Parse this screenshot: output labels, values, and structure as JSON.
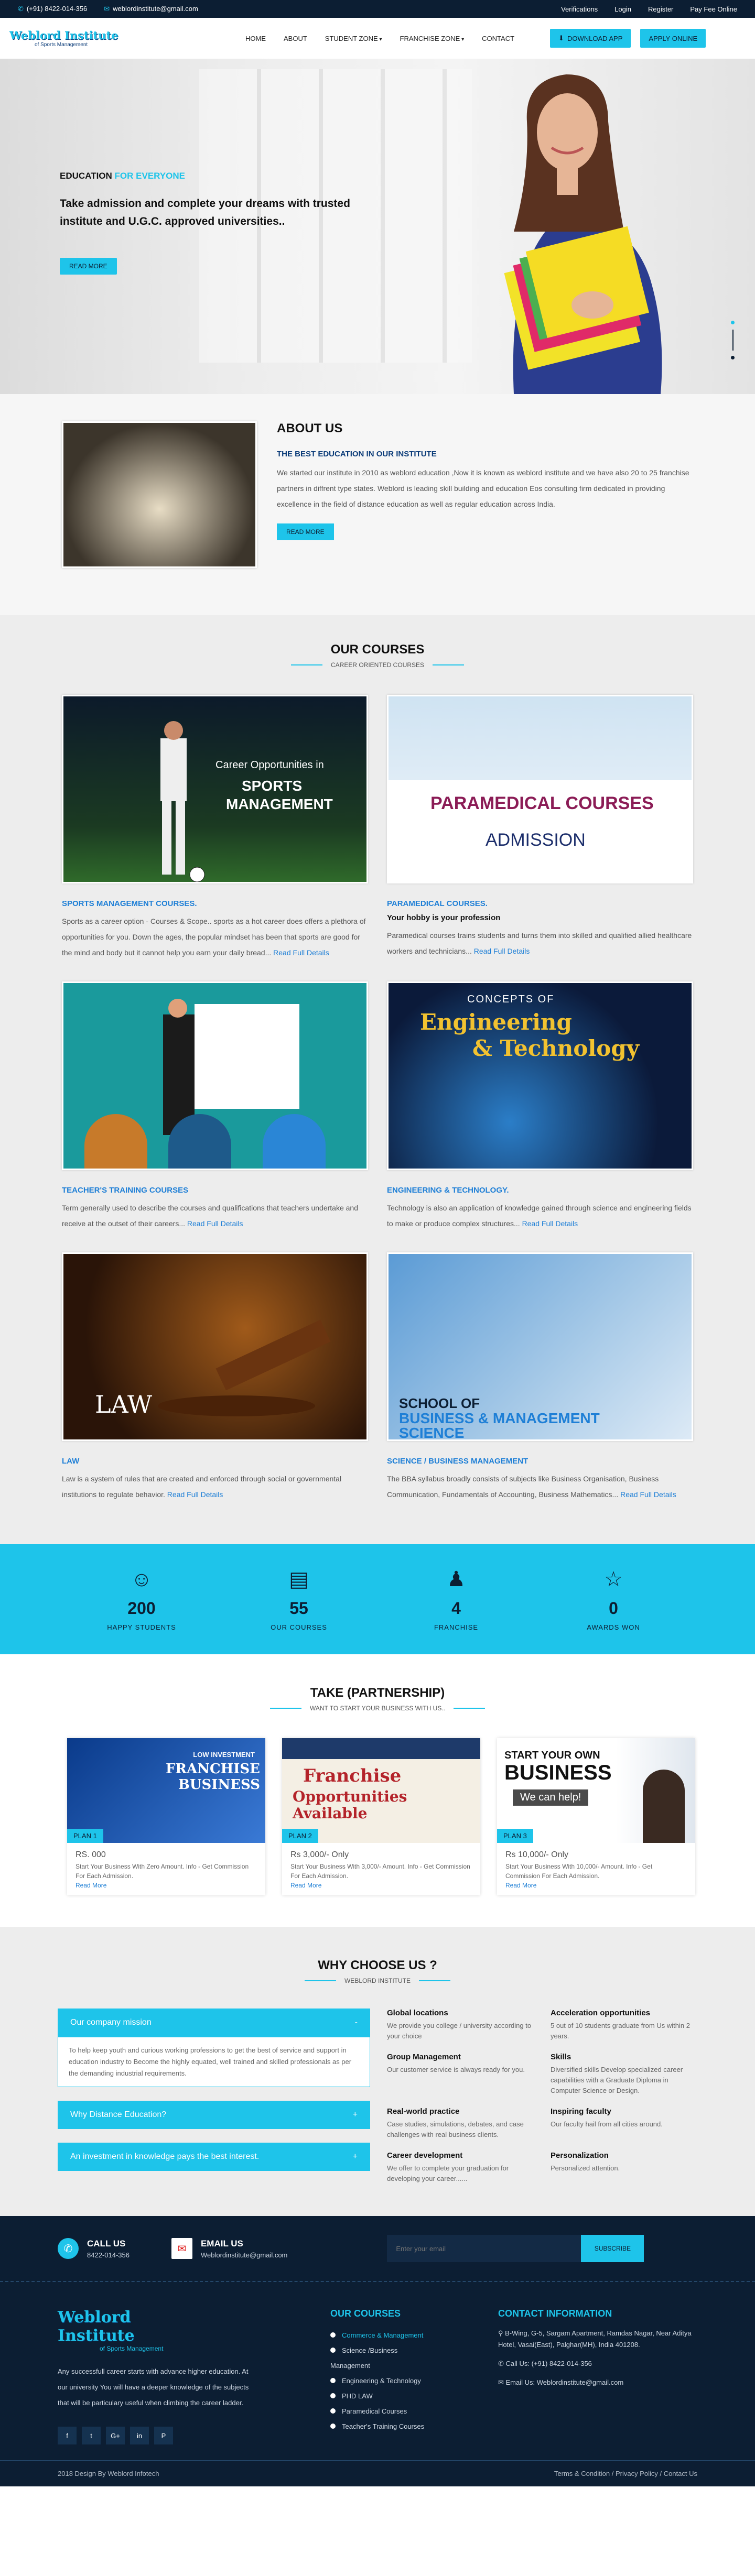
{
  "topbar": {
    "phone": "(+91) 8422-014-356",
    "email": "weblordinstitute@gmail.com",
    "links": [
      "Verifications",
      "Login",
      "Register",
      "Pay Fee Online"
    ]
  },
  "nav": {
    "logo_name": "Weblord Institute",
    "logo_tag": "of Sports Management",
    "items": [
      "HOME",
      "ABOUT",
      "STUDENT ZONE",
      "FRANCHISE ZONE",
      "CONTACT"
    ],
    "download": "DOWNLOAD APP",
    "apply": "APPLY ONLINE"
  },
  "hero": {
    "ed1": "EDUCATION",
    "ed2": "FOR EVERYONE",
    "heading": "Take admission and complete your dreams with trusted institute and U.G.C. approved universities..",
    "btn": "READ MORE"
  },
  "about": {
    "title": "ABOUT US",
    "subtitle": "THE BEST EDUCATION IN OUR INSTITUTE",
    "text": "We started our institute in 2010 as weblord education ,Now it is known as weblord institute and we have also 20 to 25 franchise partners in diffrent type states. Weblord is leading skill building and education Eos consulting firm dedicated in providing excellence in the field of distance education as well as regular education across India.",
    "btn": "READ MORE"
  },
  "courses": {
    "title": "OUR COURSES",
    "subtitle": "CAREER ORIENTED COURSES",
    "read": "Read Full Details",
    "items": [
      {
        "title": "SPORTS MANAGEMENT COURSES.",
        "hobby": "",
        "text": "Sports as a career option - Courses & Scope.. sports as a hot career does offers a plethora of opportunities for you. Down the ages, the popular mindset has been that sports are good for the mind and body but it cannot help you earn your daily bread...",
        "img1": "Career Opportunities in",
        "img2": "SPORTS",
        "img3": "MANAGEMENT"
      },
      {
        "title": "PARAMEDICAL COURSES.",
        "hobby": "Your hobby is your profession",
        "text": "Paramedical courses trains students and turns them into skilled and qualified allied healthcare workers and technicians...",
        "img1": "PARAMEDICAL COURSES",
        "img2": "ADMISSION",
        "img3": ""
      },
      {
        "title": "TEACHER'S TRAINING COURSES",
        "hobby": "",
        "text": "Term generally used to describe the courses and qualifications that teachers undertake and receive at the outset of their careers...",
        "img1": "",
        "img2": "",
        "img3": ""
      },
      {
        "title": "ENGINEERING & TECHNOLOGY.",
        "hobby": "",
        "text": "Technology is also an application of knowledge gained through science and engineering fields to make or produce complex structures...",
        "img1": "CONCEPTS OF",
        "img2": "Engineering",
        "img3": "& Technology"
      },
      {
        "title": "LAW",
        "hobby": "",
        "text": "Law is a system of rules that are created and enforced through social or governmental institutions to regulate behavior.",
        "img1": "LAW",
        "img2": "",
        "img3": ""
      },
      {
        "title": "SCIENCE / BUSINESS MANAGEMENT",
        "hobby": "",
        "text": "The BBA syllabus broadly consists of subjects like Business Organisation, Business Communication, Fundamentals of Accounting, Business Mathematics...",
        "img1": "SCHOOL OF",
        "img2": "BUSINESS & MANAGEMENT",
        "img3": "SCIENCE"
      }
    ]
  },
  "stats": [
    {
      "num": "200",
      "label": "HAPPY STUDENTS",
      "icon": "smile-icon"
    },
    {
      "num": "55",
      "label": "OUR COURSES",
      "icon": "board-icon"
    },
    {
      "num": "4",
      "label": "FRANCHISE",
      "icon": "people-icon"
    },
    {
      "num": "0",
      "label": "AWARDS WON",
      "icon": "trophy-icon"
    }
  ],
  "partner": {
    "title": "TAKE (PARTNERSHIP)",
    "subtitle": "WANT TO START YOUR BUSINESS WITH US..",
    "plans": [
      {
        "plan": "PLAN 1",
        "price": "RS. 000",
        "desc": "Start Your Business With Zero Amount. Info - Get Commission For Each Admission.",
        "rm": "Read More",
        "img1": "LOW INVESTMENT",
        "img2": "FRANCHISE BUSINESS"
      },
      {
        "plan": "PLAN 2",
        "price": "Rs 3,000/- Only",
        "desc": "Start Your Business With 3,000/- Amount. Info - Get Commission For Each Admission.",
        "rm": "Read More",
        "img1": "Franchise",
        "img2": "Opportunities Available"
      },
      {
        "plan": "PLAN 3",
        "price": "Rs 10,000/- Only",
        "desc": "Start Your Business With 10,000/- Amount. Info - Get Commission For Each Admission.",
        "rm": "Read More",
        "img1": "START YOUR OWN",
        "img2": "BUSINESS",
        "img3": "We can help!"
      }
    ]
  },
  "why": {
    "title": "WHY CHOOSE US ?",
    "subtitle": "WEBLORD INSTITUTE",
    "acc": [
      {
        "label": "Our company mission",
        "sign": "-",
        "body": "To help keep youth and curious working professions to get the best of service and support in education industry to Become the highly equated, well trained and skilled professionals as per the demanding industrial requirements."
      },
      {
        "label": "Why Distance Education?",
        "sign": "+"
      },
      {
        "label": "An investment in knowledge pays the best interest.",
        "sign": "+"
      }
    ],
    "features": [
      {
        "t": "Global locations",
        "d": "We provide you college / university according to your choice"
      },
      {
        "t": "Acceleration opportunities",
        "d": "5 out of 10 students graduate from Us within 2 years."
      },
      {
        "t": "Group Management",
        "d": "Our customer service is always ready for you."
      },
      {
        "t": "Skills",
        "d": "Diversified skills Develop specialized career capabilities with a Graduate Diploma in Computer Science or Design."
      },
      {
        "t": "Real-world practice",
        "d": "Case studies, simulations, debates, and case challenges with real business clients."
      },
      {
        "t": "Inspiring faculty",
        "d": "Our faculty hail from all cities around."
      },
      {
        "t": "Career development",
        "d": "We offer to complete your graduation for developing your career......"
      },
      {
        "t": "Personalization",
        "d": "Personalized attention."
      }
    ]
  },
  "contact": {
    "call_t": "CALL US",
    "call_v": "8422-014-356",
    "mail_t": "EMAIL US",
    "mail_v": "Weblordinstitute@gmail.com",
    "placeholder": "Enter your email",
    "subscribe": "SUBSCRIBE"
  },
  "footer": {
    "logo_name": "Weblord Institute",
    "logo_tag": "of Sports Management",
    "about": "Any successfull career starts with advance higher education. At our university You will have a deeper knowledge of the subjects that will be particulary useful when climbing the career ladder.",
    "courses_t": "OUR COURSES",
    "courses": [
      "Commerce & Management",
      "Science /Business Management",
      "Engineering & Technology",
      "PHD LAW",
      "Paramedical Courses",
      "Teacher's Training Courses"
    ],
    "contact_t": "CONTACT INFORMATION",
    "address": "B-Wing, G-5, Sargam Apartment, Ramdas Nagar, Near Aditya Hotel, Vasai(East), Palghar(MH), India 401208.",
    "call": "Call Us: (+91) 8422-014-356",
    "mail": "Email Us: Weblordinstitute@gmail.com",
    "social": [
      "f",
      "t",
      "G+",
      "in",
      "P"
    ]
  },
  "copy": {
    "text": "2018 Design By Weblord Infotech",
    "links": "Terms & Condition / Privacy Policy / Contact Us"
  },
  "colors": {
    "accent": "#1ec4ea",
    "navy": "#0c1e33",
    "link": "#1e7fd6"
  }
}
